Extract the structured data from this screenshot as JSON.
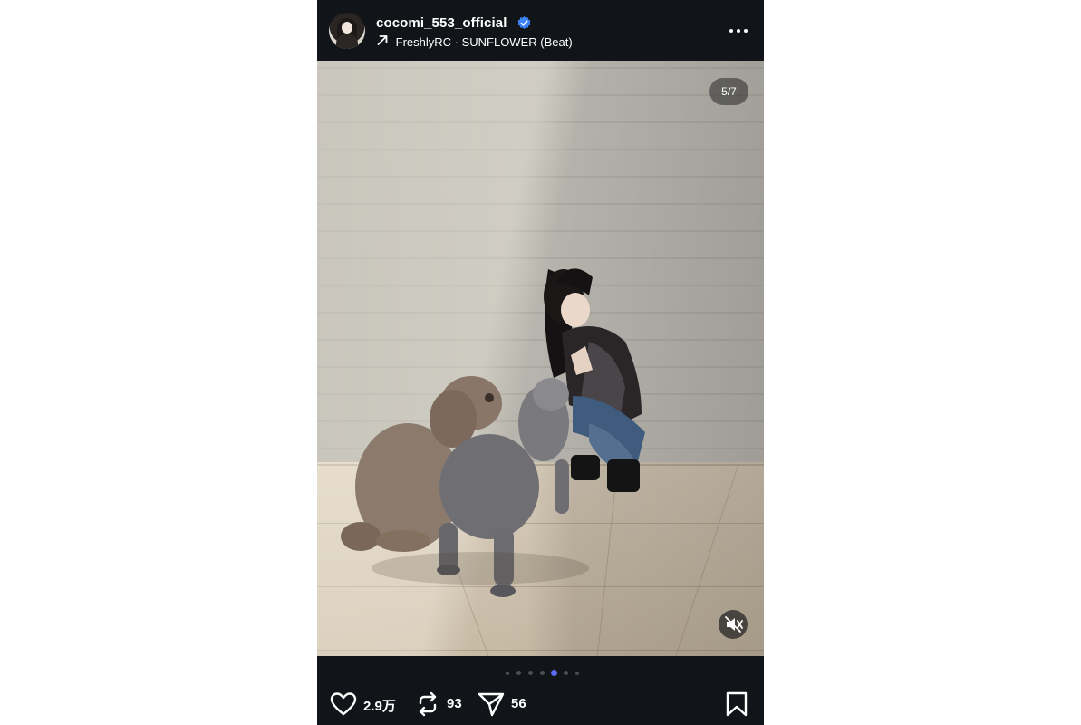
{
  "post": {
    "username": "cocomi_553_official",
    "music": "FreshlyRC · SUNFLOWER (Beat)",
    "slide_counter": "5/7",
    "carousel": {
      "count": 7,
      "active_index": 4
    },
    "likes": "2.9万",
    "reposts": "93",
    "shares": "56"
  },
  "colors": {
    "background": "#111418",
    "verified": "#3b82f6",
    "active_dot": "#5b6cf0"
  },
  "icons": [
    "verified-badge-icon",
    "arrow-up-right-icon",
    "more-icon",
    "mute-icon",
    "heart-icon",
    "repost-icon",
    "share-icon",
    "bookmark-icon"
  ]
}
